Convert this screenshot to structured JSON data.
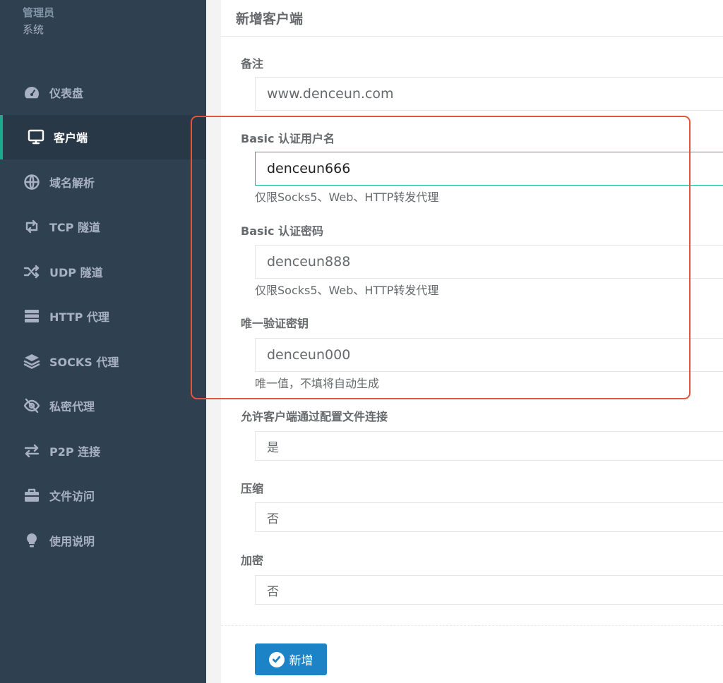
{
  "sidebar": {
    "user_role": "管理员",
    "user_sub": "系统",
    "items": [
      {
        "label": "仪表盘",
        "icon": "dashboard-icon"
      },
      {
        "label": "客户端",
        "icon": "monitor-icon",
        "active": true
      },
      {
        "label": "域名解析",
        "icon": "globe-icon"
      },
      {
        "label": "TCP 隧道",
        "icon": "retweet-icon"
      },
      {
        "label": "UDP 隧道",
        "icon": "random-icon"
      },
      {
        "label": "HTTP 代理",
        "icon": "server-icon"
      },
      {
        "label": "SOCKS 代理",
        "icon": "layers-icon"
      },
      {
        "label": "私密代理",
        "icon": "eye-slash-icon"
      },
      {
        "label": "P2P 连接",
        "icon": "exchange-icon"
      },
      {
        "label": "文件访问",
        "icon": "briefcase-icon"
      },
      {
        "label": "使用说明",
        "icon": "lightbulb-icon"
      }
    ]
  },
  "panel": {
    "title": "新增客户端"
  },
  "form": {
    "remark": {
      "label": "备注",
      "value": "www.denceun.com"
    },
    "basic_user": {
      "label": "Basic 认证用户名",
      "value": "denceun666",
      "help": "仅限Socks5、Web、HTTP转发代理"
    },
    "basic_pass": {
      "label": "Basic 认证密码",
      "value": "denceun888",
      "help": "仅限Socks5、Web、HTTP转发代理"
    },
    "unique_key": {
      "label": "唯一验证密钥",
      "value": "denceun000",
      "help": "唯一值，不填将自动生成"
    },
    "config_conn": {
      "label": "允许客户端通过配置文件连接",
      "value": "是"
    },
    "compress": {
      "label": "压缩",
      "value": "否"
    },
    "encrypt": {
      "label": "加密",
      "value": "否"
    },
    "submit_label": "新增"
  },
  "colors": {
    "sidebar_bg": "#2f4050",
    "active_accent": "#19aa8d",
    "primary_button": "#1c84c6",
    "highlight_border": "#e5533b"
  }
}
